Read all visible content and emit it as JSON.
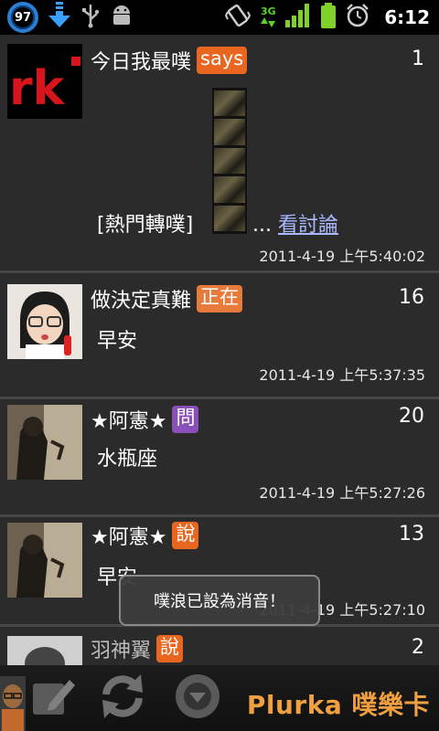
{
  "status_bar": {
    "battery_percent": "97",
    "network": "3G",
    "time": "6:12",
    "icons": [
      "download-icon",
      "usb-icon",
      "android-debug-icon",
      "vibrate-icon",
      "3g-icon",
      "signal-icon",
      "battery-icon",
      "alarm-icon"
    ]
  },
  "plurks": [
    {
      "author": "今日我最噗",
      "qualifier": "says",
      "qualifier_color": "#e8661f",
      "response_count": "1",
      "content_prefix": "[熱門轉噗]",
      "content_suffix": "...",
      "link_text": "看討論",
      "timestamp": "2011-4-19 上午5:40:02"
    },
    {
      "author": "做決定真難",
      "qualifier": "正在",
      "qualifier_color": "#e87a3c",
      "response_count": "16",
      "content": "早安",
      "timestamp": "2011-4-19 上午5:37:35"
    },
    {
      "author": "★阿憲★",
      "qualifier": "問",
      "qualifier_color": "#8a4fb8",
      "response_count": "20",
      "content": "水瓶座",
      "timestamp": "2011-4-19 上午5:27:26"
    },
    {
      "author": "★阿憲★",
      "qualifier": "說",
      "qualifier_color": "#e8661f",
      "response_count": "13",
      "content": "早安",
      "timestamp": "2011-4-19 上午5:27:10"
    },
    {
      "author": "羽神翼",
      "qualifier": "說",
      "qualifier_color": "#e8661f",
      "response_count": "2"
    }
  ],
  "toast": {
    "message": "噗浪已設為消音！"
  },
  "bottom_bar": {
    "buttons": [
      "compose-icon",
      "refresh-icon",
      "more-icon"
    ],
    "brand": "Plurka 噗樂卡"
  }
}
